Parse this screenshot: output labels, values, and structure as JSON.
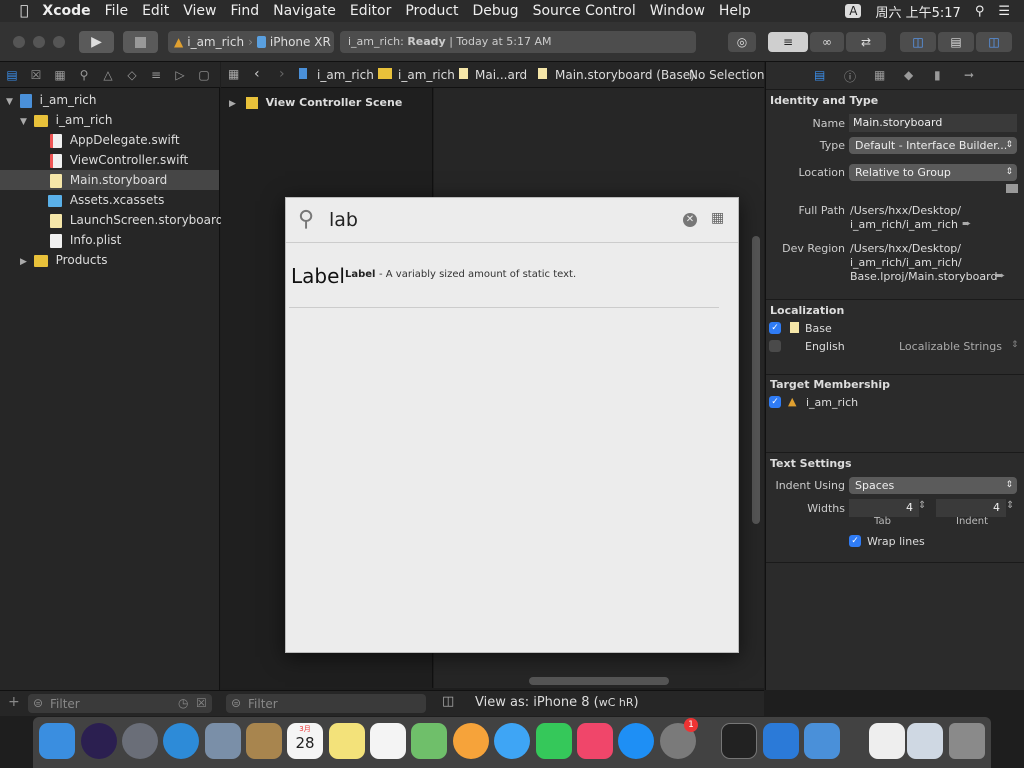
{
  "menubar": {
    "app": "Xcode",
    "items": [
      "File",
      "Edit",
      "View",
      "Find",
      "Navigate",
      "Editor",
      "Product",
      "Debug",
      "Source Control",
      "Window",
      "Help"
    ],
    "input_badge": "A",
    "clock": "周六 上午5:17"
  },
  "toolbar": {
    "scheme": "i_am_rich",
    "device": "iPhone XR",
    "activity_project": "i_am_rich:",
    "activity_status": "Ready",
    "activity_time": "| Today at 5:17 AM"
  },
  "navigator": {
    "items": [
      {
        "label": "i_am_rich"
      },
      {
        "label": "i_am_rich"
      },
      {
        "label": "AppDelegate.swift"
      },
      {
        "label": "ViewController.swift"
      },
      {
        "label": "Main.storyboard"
      },
      {
        "label": "Assets.xcassets"
      },
      {
        "label": "LaunchScreen.storyboard"
      },
      {
        "label": "Info.plist"
      },
      {
        "label": "Products"
      }
    ],
    "filter_placeholder": "Filter"
  },
  "jumpbar": {
    "crumbs": [
      "i_am_rich",
      "i_am_rich",
      "Mai...ard",
      "Main.storyboard (Base)",
      "No Selection"
    ]
  },
  "outline": {
    "scene": "View Controller Scene",
    "filter_placeholder": "Filter"
  },
  "canvas": {
    "view_as": "View as: iPhone 8 (",
    "view_as_traits": "wC hR",
    "view_as_end": ")"
  },
  "library": {
    "search_value": "lab",
    "result_icon_text": "Label",
    "result_title": "Label",
    "result_desc": "- A variably sized amount of static text."
  },
  "inspector": {
    "identity_title": "Identity and Type",
    "name_label": "Name",
    "name_value": "Main.storyboard",
    "type_label": "Type",
    "type_value": "Default - Interface Builder...",
    "location_label": "Location",
    "location_value": "Relative to Group",
    "fullpath_label": "Full Path",
    "fullpath_line1": "/Users/hxx/Desktop/",
    "fullpath_line2": "i_am_rich/i_am_rich",
    "devregion_label": "Dev Region",
    "devregion_line1": "/Users/hxx/Desktop/",
    "devregion_line2": "i_am_rich/i_am_rich/",
    "devregion_line3": "Base.lproj/Main.storyboard",
    "localization_title": "Localization",
    "loc_base": "Base",
    "loc_english": "English",
    "loc_english_value": "Localizable Strings",
    "target_title": "Target Membership",
    "target_name": "i_am_rich",
    "text_title": "Text Settings",
    "indent_label": "Indent Using",
    "indent_value": "Spaces",
    "widths_label": "Widths",
    "tab_value": "4",
    "indent_width_value": "4",
    "tab_caption": "Tab",
    "indent_caption": "Indent",
    "wrap_label": "Wrap lines"
  },
  "dock": {
    "calendar_month": "3月",
    "calendar_day": "28",
    "settings_badge": "1"
  }
}
